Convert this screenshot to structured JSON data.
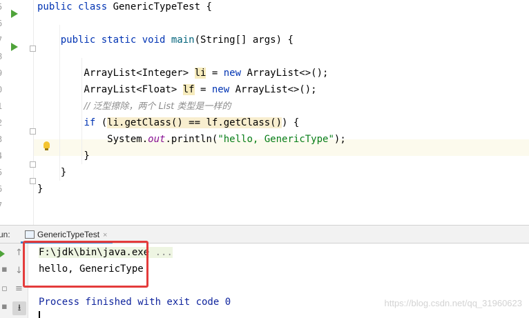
{
  "editor": {
    "line_numbers": [
      "5",
      "6",
      "7",
      "8",
      "9",
      "0",
      "1",
      "2",
      "3",
      "4",
      "5",
      "6",
      "7"
    ],
    "lines": [
      {
        "segments": [
          {
            "t": "public class ",
            "c": "kw"
          },
          {
            "t": "GenericTypeTest {",
            "c": ""
          }
        ]
      },
      {
        "segments": []
      },
      {
        "segments": [
          {
            "t": "    public static void ",
            "c": "kw"
          },
          {
            "t": "main",
            "c": "fn"
          },
          {
            "t": "(String[] args) {",
            "c": ""
          }
        ]
      },
      {
        "segments": []
      },
      {
        "segments": [
          {
            "t": "        ArrayList<Integer> ",
            "c": ""
          },
          {
            "t": "li",
            "c": "hl"
          },
          {
            "t": " = ",
            "c": ""
          },
          {
            "t": "new ",
            "c": "kw"
          },
          {
            "t": "ArrayList<>();",
            "c": ""
          }
        ]
      },
      {
        "segments": [
          {
            "t": "        ArrayList<Float> ",
            "c": ""
          },
          {
            "t": "lf",
            "c": "hl"
          },
          {
            "t": " = ",
            "c": ""
          },
          {
            "t": "new ",
            "c": "kw"
          },
          {
            "t": "ArrayList<>();",
            "c": ""
          }
        ]
      },
      {
        "segments": [
          {
            "t": "        ",
            "c": ""
          },
          {
            "t": "// 泛型擦除，两个 List 类型是一样的",
            "c": "cm"
          }
        ]
      },
      {
        "segments": [
          {
            "t": "        ",
            "c": ""
          },
          {
            "t": "if ",
            "c": "kw"
          },
          {
            "t": "(",
            "c": ""
          },
          {
            "t": "li.getClass() == lf.getClass()",
            "c": "hl2"
          },
          {
            "t": ") {",
            "c": ""
          }
        ]
      },
      {
        "segments": [
          {
            "t": "            System.",
            "c": ""
          },
          {
            "t": "out",
            "c": "fld"
          },
          {
            "t": ".println(",
            "c": ""
          },
          {
            "t": "\"hello, GenericType\"",
            "c": "str"
          },
          {
            "t": ");",
            "c": ""
          }
        ]
      },
      {
        "segments": [
          {
            "t": "        }",
            "c": ""
          }
        ]
      },
      {
        "segments": [
          {
            "t": "    }",
            "c": ""
          }
        ]
      },
      {
        "segments": [
          {
            "t": "}",
            "c": ""
          }
        ]
      },
      {
        "segments": []
      }
    ]
  },
  "run_panel": {
    "label": "un:",
    "tab_title": "GenericTypeTest",
    "tab_close": "×"
  },
  "console": {
    "command": "F:\\jdk\\bin\\java.exe",
    "command_more": " ...",
    "output": "hello, GenericType",
    "exit_message": "Process finished with exit code 0"
  },
  "watermark": "https://blog.csdn.net/qq_31960623",
  "colors": {
    "keyword": "#0033b3",
    "string": "#067d17",
    "comment": "#8c8c8c",
    "field": "#871094",
    "exit_text": "#0f249d",
    "highlight_box": "#e43b3b",
    "run_icon": "#4fa33a"
  }
}
